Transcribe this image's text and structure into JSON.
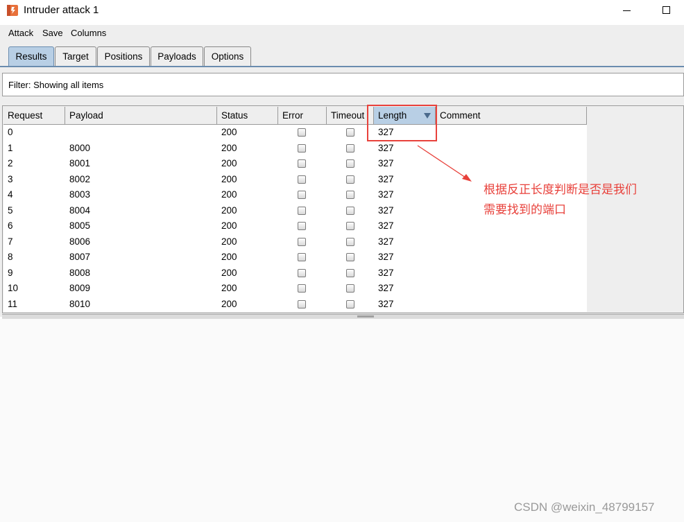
{
  "window": {
    "title": "Intruder attack 1"
  },
  "menu": [
    "Attack",
    "Save",
    "Columns"
  ],
  "tabs": [
    "Results",
    "Target",
    "Positions",
    "Payloads",
    "Options"
  ],
  "active_tab": "Results",
  "filter": {
    "text": "Filter:  Showing all items"
  },
  "table": {
    "columns": [
      "Request",
      "Payload",
      "Status",
      "Error",
      "Timeout",
      "Length",
      "Comment"
    ],
    "sorted_column": "Length",
    "rows": [
      {
        "request": "0",
        "payload": "",
        "status": "200",
        "error": false,
        "timeout": false,
        "length": "327",
        "comment": ""
      },
      {
        "request": "1",
        "payload": "8000",
        "status": "200",
        "error": false,
        "timeout": false,
        "length": "327",
        "comment": ""
      },
      {
        "request": "2",
        "payload": "8001",
        "status": "200",
        "error": false,
        "timeout": false,
        "length": "327",
        "comment": ""
      },
      {
        "request": "3",
        "payload": "8002",
        "status": "200",
        "error": false,
        "timeout": false,
        "length": "327",
        "comment": ""
      },
      {
        "request": "4",
        "payload": "8003",
        "status": "200",
        "error": false,
        "timeout": false,
        "length": "327",
        "comment": ""
      },
      {
        "request": "5",
        "payload": "8004",
        "status": "200",
        "error": false,
        "timeout": false,
        "length": "327",
        "comment": ""
      },
      {
        "request": "6",
        "payload": "8005",
        "status": "200",
        "error": false,
        "timeout": false,
        "length": "327",
        "comment": ""
      },
      {
        "request": "7",
        "payload": "8006",
        "status": "200",
        "error": false,
        "timeout": false,
        "length": "327",
        "comment": ""
      },
      {
        "request": "8",
        "payload": "8007",
        "status": "200",
        "error": false,
        "timeout": false,
        "length": "327",
        "comment": ""
      },
      {
        "request": "9",
        "payload": "8008",
        "status": "200",
        "error": false,
        "timeout": false,
        "length": "327",
        "comment": ""
      },
      {
        "request": "10",
        "payload": "8009",
        "status": "200",
        "error": false,
        "timeout": false,
        "length": "327",
        "comment": ""
      },
      {
        "request": "11",
        "payload": "8010",
        "status": "200",
        "error": false,
        "timeout": false,
        "length": "327",
        "comment": ""
      }
    ]
  },
  "annotation": {
    "line1": "根据反正长度判断是否是我们",
    "line2": "需要找到的端口"
  },
  "watermark": "CSDN @weixin_48799157",
  "colors": {
    "highlight": "#e8413b",
    "active_tab": "#b8cfe5",
    "app_icon": "#e8713b"
  },
  "icons": {
    "app": "burp-logo-icon",
    "sort": "sort-descending-icon",
    "minimize": "minimize-icon",
    "maximize": "maximize-icon",
    "arrow": "annotation-arrow-icon"
  }
}
